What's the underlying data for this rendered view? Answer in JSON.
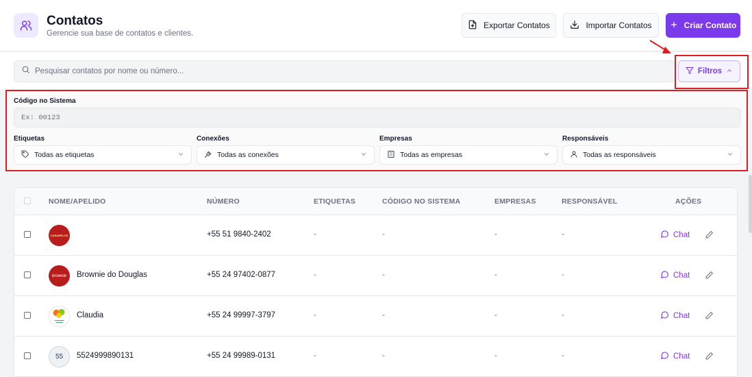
{
  "header": {
    "title": "Contatos",
    "subtitle": "Gerencie sua base de contatos e clientes.",
    "export_label": "Exportar Contatos",
    "import_label": "Importar Contatos",
    "create_label": "Criar Contato"
  },
  "search": {
    "placeholder": "Pesquisar contatos por nome ou número...",
    "filters_label": "Filtros"
  },
  "filters": {
    "code_label": "Código no Sistema",
    "code_placeholder": "Ex: 00123",
    "tags_label": "Etiquetas",
    "tags_value": "Todas as etiquetas",
    "connections_label": "Conexões",
    "connections_value": "Todas as conexões",
    "companies_label": "Empresas",
    "companies_value": "Todas as empresas",
    "owners_label": "Responsáveis",
    "owners_value": "Todas as responsáveis"
  },
  "table": {
    "columns": [
      "NOME/APELIDO",
      "NÚMERO",
      "ETIQUETAS",
      "CÓDIGO NO SISTEMA",
      "EMPRESAS",
      "RESPONSÁVEL",
      "AÇÕES"
    ],
    "chat_label": "Chat",
    "rows": [
      {
        "name": "",
        "number": "+55 51 9840-2402",
        "tags": "-",
        "code": "-",
        "companies": "-",
        "owner": "-",
        "avatar_text": "CASAMELOS"
      },
      {
        "name": "Brownie do Douglas",
        "number": "+55 24 97402-0877",
        "tags": "-",
        "code": "-",
        "companies": "-",
        "owner": "-",
        "avatar_text": "brownie"
      },
      {
        "name": "Claudia",
        "number": "+55 24 99997-3797",
        "tags": "-",
        "code": "-",
        "companies": "-",
        "owner": "-",
        "avatar_text": ""
      },
      {
        "name": "5524999890131",
        "number": "+55 24 99989-0131",
        "tags": "-",
        "code": "-",
        "companies": "-",
        "owner": "-",
        "avatar_text": "55"
      }
    ]
  },
  "colors": {
    "accent": "#7c3aed",
    "highlight": "#e11d1d"
  }
}
